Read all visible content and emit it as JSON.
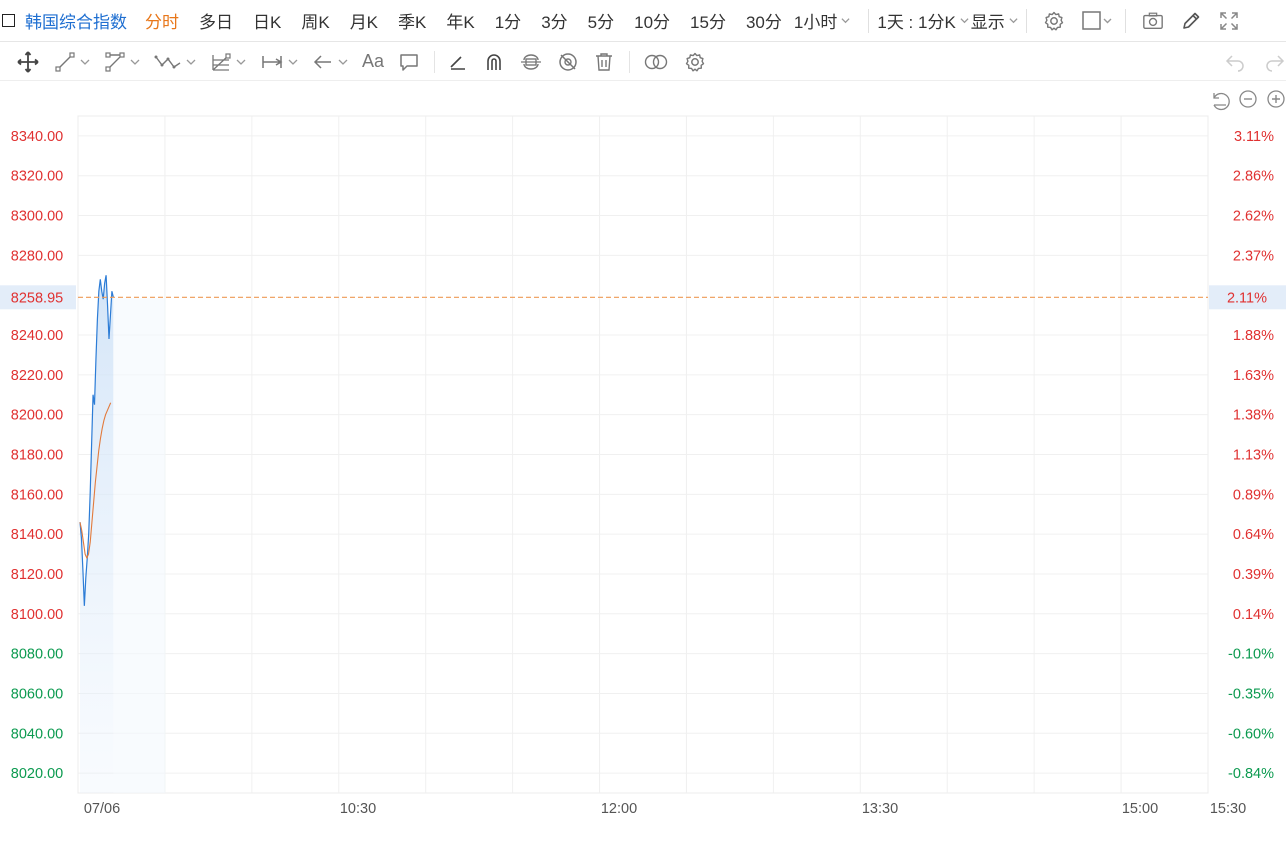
{
  "toolbar": {
    "title": "韩国综合指数",
    "periods": [
      "分时",
      "多日",
      "日K",
      "周K",
      "月K",
      "季K",
      "年K",
      "1分",
      "3分",
      "5分",
      "10分",
      "15分",
      "30分"
    ],
    "active_period": "分时",
    "hour_dropdown": "1小时",
    "range_dropdown": "1天 : 1分K",
    "display_dropdown": "显示",
    "icons": [
      "settings-icon",
      "square-icon",
      "camera-icon",
      "pencil-icon",
      "fullscreen-icon"
    ]
  },
  "drawbar": {
    "tools": [
      "move-icon",
      "line-tool-icon",
      "polyline-tool-icon",
      "wave-tool-icon",
      "fib-tool-icon",
      "measure-tool-icon",
      "arrow-tool-icon",
      "text-tool-icon",
      "comment-tool-icon",
      "ruler-icon",
      "magnet-icon",
      "lock-icon",
      "hide-icon",
      "trash-icon",
      "link-icon",
      "draw-settings-icon",
      "undo-icon",
      "redo-icon"
    ],
    "text_tool_label": "Aa"
  },
  "chart_controls": [
    "reset-icon",
    "zoom-out-icon",
    "zoom-in-icon"
  ],
  "chart_data": {
    "type": "line",
    "x_ticks": [
      "07/06",
      "10:30",
      "12:00",
      "13:30",
      "15:00",
      "15:30"
    ],
    "y_ticks_left": [
      "8340.00",
      "8320.00",
      "8300.00",
      "8280.00",
      "8240.00",
      "8220.00",
      "8200.00",
      "8180.00",
      "8160.00",
      "8140.00",
      "8120.00",
      "8100.00",
      "8080.00",
      "8060.00",
      "8040.00",
      "8020.00"
    ],
    "y_ticks_right": [
      "3.11%",
      "2.86%",
      "2.62%",
      "2.37%",
      "1.88%",
      "1.63%",
      "1.38%",
      "1.13%",
      "0.89%",
      "0.64%",
      "0.39%",
      "0.14%",
      "-0.10%",
      "-0.35%",
      "-0.60%",
      "-0.84%"
    ],
    "current_price_label": "8258.95",
    "current_pct_label": "2.11%",
    "ylim": [
      8010,
      8350
    ],
    "baseline": 8088.5,
    "price_series": [
      8146,
      8138,
      8122,
      8104,
      8118,
      8128,
      8140,
      8160,
      8185,
      8210,
      8205,
      8228,
      8248,
      8262,
      8268,
      8262,
      8258,
      8266,
      8270,
      8255,
      8238,
      8250,
      8262,
      8259
    ],
    "avg_series": [
      8146,
      8142,
      8136,
      8130,
      8128,
      8130,
      8136,
      8146,
      8156,
      8166,
      8174,
      8182,
      8188,
      8193,
      8197,
      8200,
      8202,
      8204,
      8206
    ],
    "up_color": "#e03131",
    "down_color": "#0b9a4f",
    "price_line_color": "#2c7cd6",
    "avg_line_color": "#e27a3c",
    "current_line_color": "#ee9a56"
  }
}
